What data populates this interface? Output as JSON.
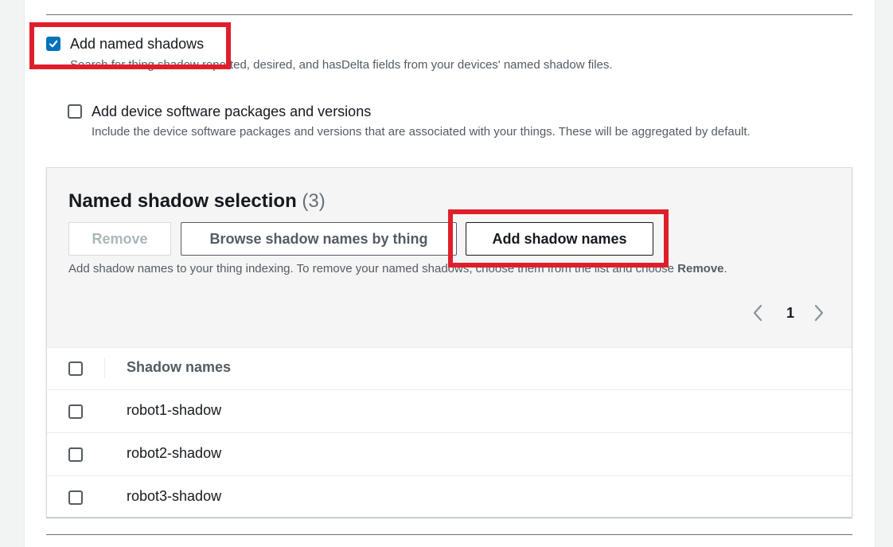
{
  "options": {
    "named_shadows": {
      "label": "Add named shadows",
      "description": "Search for thing shadow reported, desired, and hasDelta fields from your devices' named shadow files.",
      "checked": true
    },
    "software_packages": {
      "label": "Add device software packages and versions",
      "description": "Include the device software packages and versions that are associated with your things. These will be aggregated by default.",
      "checked": false
    }
  },
  "named_shadow_selection": {
    "title": "Named shadow selection",
    "count": "(3)",
    "buttons": {
      "remove": "Remove",
      "browse": "Browse shadow names by thing",
      "add": "Add shadow names"
    },
    "helper_text": "Add shadow names to your thing indexing. To remove your named shadows, choose them from the list and choose ",
    "helper_emphasis": "Remove",
    "helper_end": ".",
    "pagination": {
      "current_page": "1",
      "prev_icon": "chevron-left-icon",
      "next_icon": "chevron-right-icon"
    },
    "table": {
      "column_header": "Shadow names",
      "rows": [
        "robot1-shadow",
        "robot2-shadow",
        "robot3-shadow"
      ]
    }
  },
  "colors": {
    "checkbox_checked": "#0073bb",
    "highlight": "#e01e2b"
  }
}
